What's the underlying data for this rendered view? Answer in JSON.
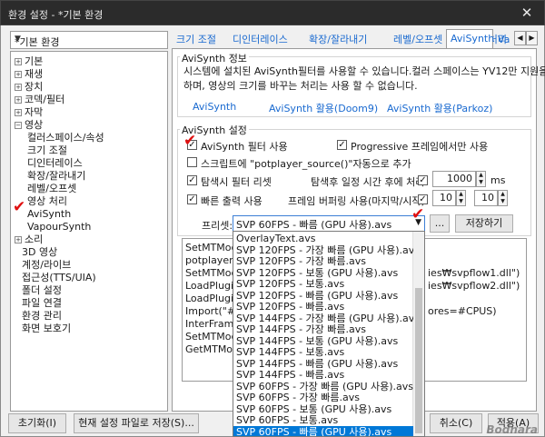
{
  "window": {
    "title": "환경 설정 - *기본 환경",
    "close_symbol": "✕"
  },
  "profile": {
    "value": "*기본 환경"
  },
  "tree": {
    "items": [
      {
        "label": "기본",
        "expander": "+"
      },
      {
        "label": "재생",
        "expander": "+"
      },
      {
        "label": "장치",
        "expander": "+"
      },
      {
        "label": "코덱/필터",
        "expander": "+"
      },
      {
        "label": "자막",
        "expander": "+"
      },
      {
        "label": "영상",
        "expander": "−"
      },
      {
        "label": "컬러스페이스/속성"
      },
      {
        "label": "크기 조절"
      },
      {
        "label": "디인터레이스"
      },
      {
        "label": "확장/잘라내기"
      },
      {
        "label": "레벨/오프셋"
      },
      {
        "label": "영상 처리"
      },
      {
        "label": "AviSynth"
      },
      {
        "label": "VapourSynth"
      },
      {
        "label": "소리",
        "expander": "+"
      },
      {
        "label": "3D 영상"
      },
      {
        "label": "계정/라이브"
      },
      {
        "label": "접근성(TTS/UIA)"
      },
      {
        "label": "폴더 설정"
      },
      {
        "label": "파일 연결"
      },
      {
        "label": "환경 관리"
      },
      {
        "label": "화면 보호기"
      }
    ]
  },
  "tabs": [
    "크기 조절",
    "디인터레이스",
    "확장/잘라내기",
    "레벨/오프셋",
    "영상 처리",
    "AviSynth",
    "Va"
  ],
  "avisynth_info": {
    "title": "AviSynth 정보",
    "line1": "시스템에 설치된 AviSynth필터를 사용할 수 있습니다.컬러 스페이스는 YV12만 지원을",
    "line2": "하며, 영상의 크기를 바꾸는 처리는 사용 할 수 없습니다.",
    "links": [
      "AviSynth",
      "AviSynth 활용(Doom9)",
      "AviSynth 활용(Parkoz)"
    ]
  },
  "avisynth_settings": {
    "title": "AviSynth 설정",
    "use_filter": "AviSynth 필터 사용",
    "progressive_only": "Progressive 프레임에서만 사용",
    "auto_add": "스크립트에 \"potplayer_source()\"자동으로 추가",
    "seek_reset": "탐색시 필터 리셋",
    "seek_delay_label": "탐색후 일정 시간 후에 처리",
    "seek_delay_value": "1000",
    "seek_delay_unit": "ms",
    "fast_output": "빠른 출력 사용",
    "frame_buffer_label": "프레임 버퍼링 사용(마지막/시작)",
    "frame_buffer_last": "10",
    "frame_buffer_start": "10",
    "check_symbol": "✓"
  },
  "preset": {
    "label": "프리셋:",
    "selected": "SVP 60FPS - 빠름 (GPU 사용).avs",
    "more_button": "...",
    "save_button": "저장하기"
  },
  "script_lines": [
    "SetMTMode",
    "potplayer_so",
    "SetMTMode",
    "LoadPlugin(",
    "LoadPlugin(",
    "Import(\"#PR",
    "InterFrame(",
    "SetMTMode",
    "GetMTMode"
  ],
  "script_tails": [
    "ies₩svpflow1.dll\")",
    "ies₩svpflow2.dll\")",
    "ores=#CPUS)"
  ],
  "preset_options": [
    "OverlayText.avs",
    "SVP 120FPS - 가장 빠름 (GPU 사용).avs",
    "SVP 120FPS - 가장 빠름.avs",
    "SVP 120FPS - 보통 (GPU 사용).avs",
    "SVP 120FPS - 보통.avs",
    "SVP 120FPS - 빠름 (GPU 사용).avs",
    "SVP 120FPS - 빠름.avs",
    "SVP 144FPS - 가장 빠름 (GPU 사용).avs",
    "SVP 144FPS - 가장 빠름.avs",
    "SVP 144FPS - 보통 (GPU 사용).avs",
    "SVP 144FPS - 보통.avs",
    "SVP 144FPS - 빠름 (GPU 사용).avs",
    "SVP 144FPS - 빠름.avs",
    "SVP 60FPS - 가장 빠름 (GPU 사용).avs",
    "SVP 60FPS - 가장 빠름.avs",
    "SVP 60FPS - 보통 (GPU 사용).avs",
    "SVP 60FPS - 보통.avs",
    "SVP 60FPS - 빠름 (GPU 사용).avs"
  ],
  "bottom": {
    "reset": "초기화(I)",
    "save_current": "현재 설정 파일로 저장(S)...",
    "cancel": "취소(C)",
    "apply": "적용(A)"
  },
  "watermark": "Bodnara",
  "colors": {
    "accent": "#0078d7",
    "link": "#1a6ad0",
    "annotation": "#e01010"
  }
}
